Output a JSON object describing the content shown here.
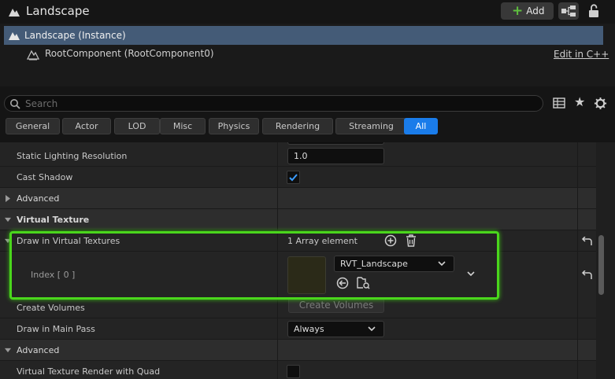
{
  "header": {
    "title": "Landscape",
    "add_label": "Add",
    "icons": [
      "landscape-icon",
      "plus-icon",
      "hierarchy-icon",
      "unlock-icon"
    ]
  },
  "components": {
    "instance": "Landscape (Instance)",
    "root": "RootComponent (RootComponent0)",
    "edit_cpp": "Edit in C++"
  },
  "search": {
    "placeholder": "Search",
    "value": ""
  },
  "filters": [
    "General",
    "Actor",
    "LOD",
    "Misc",
    "Physics",
    "Rendering",
    "Streaming",
    "All"
  ],
  "active_filter": "All",
  "properties": {
    "static_lighting_resolution": {
      "label": "Static Lighting Resolution",
      "value": "1.0"
    },
    "cast_shadow": {
      "label": "Cast Shadow",
      "checked": true
    },
    "advanced_1": "Advanced",
    "virtual_texture": "Virtual Texture",
    "draw_in_vt": {
      "label": "Draw in Virtual Textures",
      "value": "1 Array element"
    },
    "index": {
      "label": "Index [ 0 ]",
      "asset": "RVT_Landscape"
    },
    "create_volumes": {
      "label": "Create Volumes",
      "button": "Create Volumes"
    },
    "draw_main_pass": {
      "label": "Draw in Main Pass",
      "value": "Always"
    },
    "advanced_2": "Advanced",
    "vt_quad": {
      "label": "Virtual Texture Render with Quad",
      "checked": false
    }
  },
  "colors": {
    "accent": "#1a7cea",
    "selection": "#445b77",
    "highlight": "#4ad61c",
    "texture": "#2b2a18"
  }
}
